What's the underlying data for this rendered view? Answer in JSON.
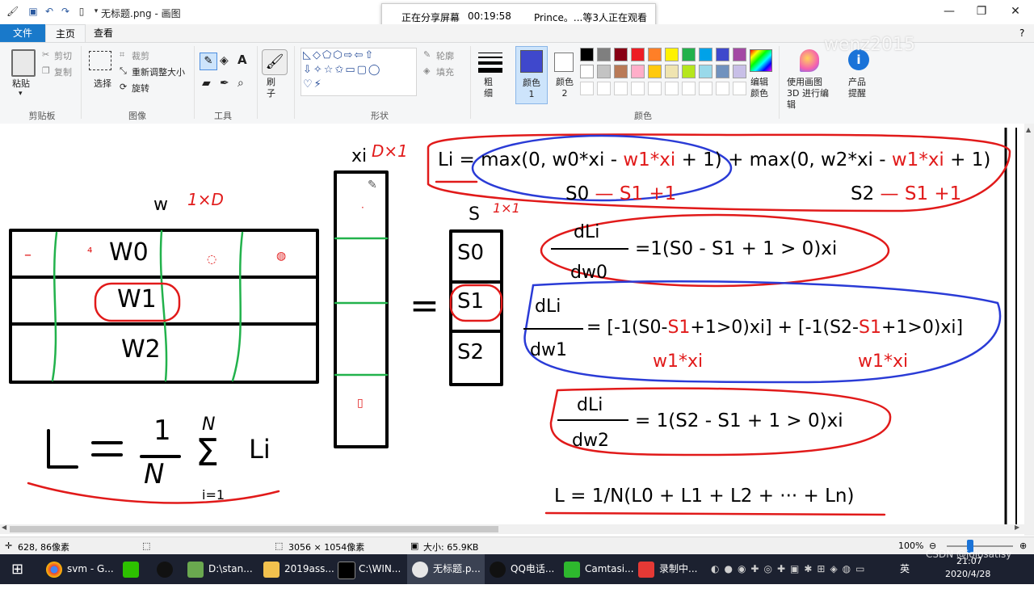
{
  "window": {
    "title": "无标题.png - 画图",
    "share_status": "正在分享屏幕",
    "share_time": "00:19:58",
    "share_viewers": "Prince。...等3人正在观看"
  },
  "tabs": [
    {
      "label": "文件"
    },
    {
      "label": "主页"
    },
    {
      "label": "查看"
    }
  ],
  "ribbon": {
    "clipboard": {
      "paste": "粘贴",
      "cut": "剪切",
      "copy": "复制",
      "group": "剪贴板"
    },
    "image": {
      "select": "选择",
      "crop": "裁剪",
      "resize": "重新调整大小",
      "rotate": "旋转",
      "group": "图像"
    },
    "tools": {
      "group": "工具"
    },
    "brush": {
      "label": "刷子"
    },
    "shapes": {
      "outline": "轮廓",
      "fill": "填充",
      "group": "形状"
    },
    "size": {
      "label": "粗细"
    },
    "color1": {
      "label": "颜色 1"
    },
    "color2": {
      "label": "颜色 2"
    },
    "colors": {
      "group": "颜色",
      "edit": "编辑颜色"
    },
    "paint3d": {
      "label": "使用画图 3D 进行编辑"
    },
    "product": {
      "label": "产品提醒"
    },
    "palette_row1": [
      "#000000",
      "#7f7f7f",
      "#880015",
      "#ed1c24",
      "#ff7f27",
      "#fff200",
      "#22b14c",
      "#00a2e8",
      "#3f48cc",
      "#a349a4"
    ],
    "palette_row2": [
      "#ffffff",
      "#c3c3c3",
      "#b97a57",
      "#ffaec9",
      "#ffc90e",
      "#efe4b0",
      "#b5e61d",
      "#99d9ea",
      "#7092be",
      "#c8bfe7"
    ],
    "color1_value": "#3f48cc",
    "watermark": "wenz2015"
  },
  "canvas": {
    "w_label": "w",
    "w_dims": "1×D",
    "xi_label": "xi",
    "xi_dims": "D×1",
    "s_label": "S",
    "s_dims": "1×1",
    "w_rows": [
      "W0",
      "W1",
      "W2"
    ],
    "s_rows": [
      "S0",
      "S1",
      "S2"
    ],
    "equals": "=",
    "eq_li_left": "Li = max(0, w0*xi - ",
    "eq_li_red1": "w1*xi",
    "eq_li_mid": " + 1) + max(0, w2*xi - ",
    "eq_li_red2": "w1*xi",
    "eq_li_end": " + 1)",
    "sub1_black": "S0",
    "sub1_red": "— S1 +1",
    "sub2_black": "S2",
    "sub2_red": "— S1 +1",
    "d0_num": "dLi",
    "d0_den": "dw0",
    "d0_rhs": "=1(S0 - S1 + 1 > 0)xi",
    "d1_num": "dLi",
    "d1_den": "dw1",
    "d1_rhs_a": "= [-1(S0-",
    "d1_rhs_b": "S1",
    "d1_rhs_c": "+1>0)xi] + [-1(S2-",
    "d1_rhs_d": "S1",
    "d1_rhs_e": "+1>0)xi]",
    "d1_note1": "w1*xi",
    "d1_note2": "w1*xi",
    "d2_num": "dLi",
    "d2_den": "dw2",
    "d2_rhs": "= 1(S2 - S1 + 1 > 0)xi",
    "loss_total": "L = 1/N(L0 + L1 + L2 + ··· + Ln)",
    "hand_L": "L",
    "hand_eq": "=",
    "hand_1": "1",
    "hand_N": "N",
    "hand_sigma": "Σ",
    "hand_sum_top": "N",
    "hand_sum_bottom": "i=1",
    "hand_Li": "Li"
  },
  "status": {
    "cursor": "628, 86像素",
    "dimensions": "3056 × 1054像素",
    "size": "大小: 65.9KB",
    "zoom": "100%",
    "zoom_level_pct": 35
  },
  "taskbar": {
    "items": [
      {
        "label": "svm - G..."
      },
      {
        "label": ""
      },
      {
        "label": ""
      },
      {
        "label": "D:\\stan..."
      },
      {
        "label": "2019ass..."
      },
      {
        "label": "C:\\WIN..."
      },
      {
        "label": "无标题.p..."
      },
      {
        "label": "QQ电话..."
      },
      {
        "label": "Camtasi..."
      },
      {
        "label": "录制中..."
      }
    ],
    "lang": "英",
    "time": "21:07",
    "date": "2020/4/28",
    "watermark": "CSDN @jojosatisy"
  }
}
